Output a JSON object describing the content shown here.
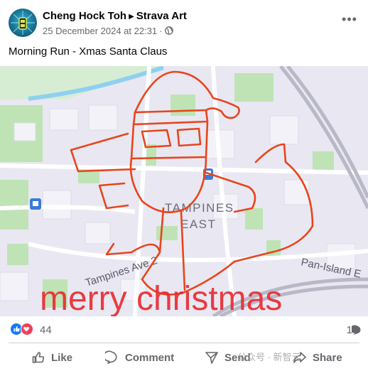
{
  "post": {
    "author": "Cheng Hock Toh",
    "separator_icon": "caret-right",
    "group": "Strava Art",
    "date": "25 December 2024 at 22:31",
    "meta_dot": "·",
    "privacy_icon": "globe-icon",
    "more_label": "•••",
    "text": "Morning Run - Xmas Santa Claus"
  },
  "map_image": {
    "label_district_1": "TAMPINES",
    "label_district_2": "EAST",
    "label_road_1": "Tampines Ave 2",
    "label_road_2": "Pan-Island E",
    "overlay_text": "merry christmas",
    "route_color": "#e8451b",
    "overlay_text_color": "#e8282e"
  },
  "reactions": {
    "count": "44",
    "comments": "1",
    "like_color": "#1877f2",
    "love_color": "#f33e58"
  },
  "actions": {
    "like": "Like",
    "comment": "Comment",
    "send": "Send",
    "share": "Share"
  },
  "watermark": "公众号 · 新智元"
}
